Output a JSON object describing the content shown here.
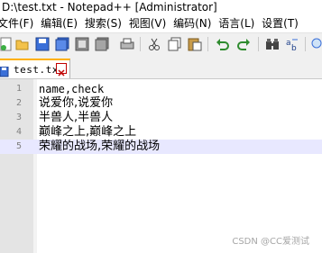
{
  "window": {
    "title": "D:\\test.txt - Notepad++ [Administrator]"
  },
  "menu": {
    "items": [
      "文件(F)",
      "编辑(E)",
      "搜索(S)",
      "视图(V)",
      "编码(N)",
      "语言(L)",
      "设置(T)"
    ]
  },
  "toolbar": {
    "icons": [
      "new-file-icon",
      "open-file-icon",
      "save-icon",
      "save-all-icon",
      "close-icon",
      "close-all-icon",
      "print-icon",
      "cut-icon",
      "copy-icon",
      "paste-icon",
      "undo-icon",
      "redo-icon",
      "find-icon",
      "replace-icon",
      "zoom-icon"
    ],
    "colors": {
      "undo": "#2e8b2e",
      "redo": "#2e8b2e",
      "accent": "#ffb000"
    }
  },
  "tabs": [
    {
      "label": "test.txt",
      "active": true
    }
  ],
  "editor": {
    "active_line": 5,
    "lines": [
      {
        "number": "1",
        "text": "name,check"
      },
      {
        "number": "2",
        "text": "说爱你,说爱你"
      },
      {
        "number": "3",
        "text": "半兽人,半兽人"
      },
      {
        "number": "4",
        "text": "巅峰之上,巅峰之上"
      },
      {
        "number": "5",
        "text": "荣耀的战场,荣耀的战场"
      }
    ]
  },
  "watermark": {
    "text": "CSDN @CC爱测试"
  }
}
